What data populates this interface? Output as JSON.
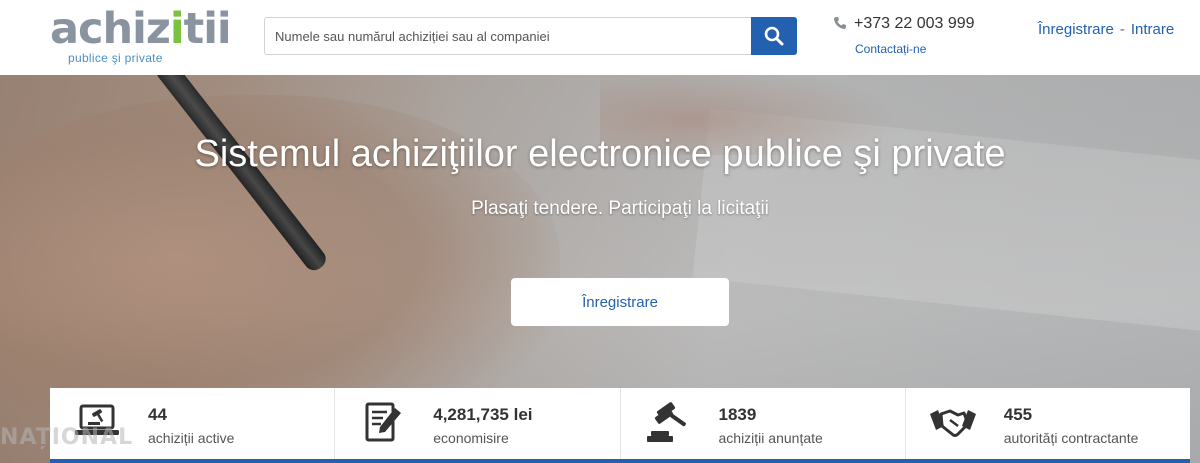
{
  "header": {
    "logo_text_pre": "achiz",
    "logo_text_green": "i",
    "logo_text_post": "tii",
    "logo_sub": "publice şi private",
    "search_placeholder": "Numele sau numărul achiziției sau al companiei",
    "phone": "+373 22 003 999",
    "contact_label": "Contactați-ne",
    "register_label": "Înregistrare",
    "separator": "-",
    "login_label": "Intrare"
  },
  "hero": {
    "title": "Sistemul achiziţiilor electronice publice şi private",
    "subtitle": "Plasaţi tendere. Participaţi la licitaţii",
    "button_label": "Înregistrare"
  },
  "stats": [
    {
      "value": "44",
      "label": "achiziții active",
      "icon": "laptop-auction-icon"
    },
    {
      "value": "4,281,735 lei",
      "label": "economisire",
      "icon": "document-edit-icon"
    },
    {
      "value": "1839",
      "label": "achiziții anunțate",
      "icon": "gavel-icon"
    },
    {
      "value": "455",
      "label": "autorități contractante",
      "icon": "handshake-icon"
    }
  ],
  "watermark": "NAȚIONAL",
  "colors": {
    "brand_blue": "#2361b0",
    "logo_green": "#7cc242",
    "logo_gray": "#8a93a0"
  }
}
